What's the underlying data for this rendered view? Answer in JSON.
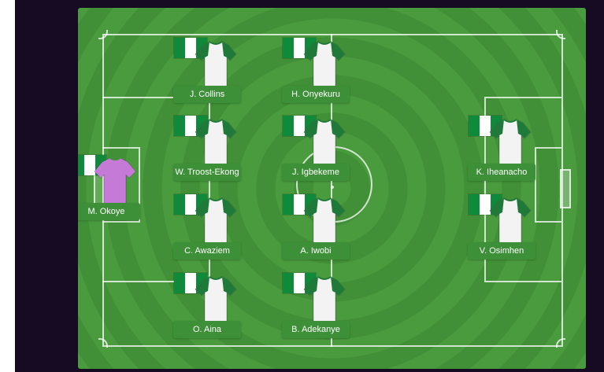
{
  "lineup": {
    "colors": {
      "pitch_stripe_a": "#4a9a3e",
      "pitch_stripe_b": "#418f36",
      "label_bg": "#3d8f38",
      "outfield_shirt_body": "#f3f3f3",
      "outfield_shirt_sleeve": "#1f7a3a",
      "goalkeeper_shirt": "#c47ad6",
      "flag_green": "#0f8a3a",
      "flag_white": "#ffffff"
    },
    "flag_icon": "nigeria-flag-icon",
    "players": [
      {
        "name": "J. Collins",
        "kit": "outfield"
      },
      {
        "name": "H. Onyekuru",
        "kit": "outfield"
      },
      {
        "name": "W. Troost-Ekong",
        "kit": "outfield"
      },
      {
        "name": "J. Igbekeme",
        "kit": "outfield"
      },
      {
        "name": "K. Iheanacho",
        "kit": "outfield"
      },
      {
        "name": "M. Okoye",
        "kit": "goalkeeper"
      },
      {
        "name": "C. Awaziem",
        "kit": "outfield"
      },
      {
        "name": "A. Iwobi",
        "kit": "outfield"
      },
      {
        "name": "V. Osimhen",
        "kit": "outfield"
      },
      {
        "name": "O. Aina",
        "kit": "outfield"
      },
      {
        "name": "B. Adekanye",
        "kit": "outfield"
      }
    ]
  }
}
